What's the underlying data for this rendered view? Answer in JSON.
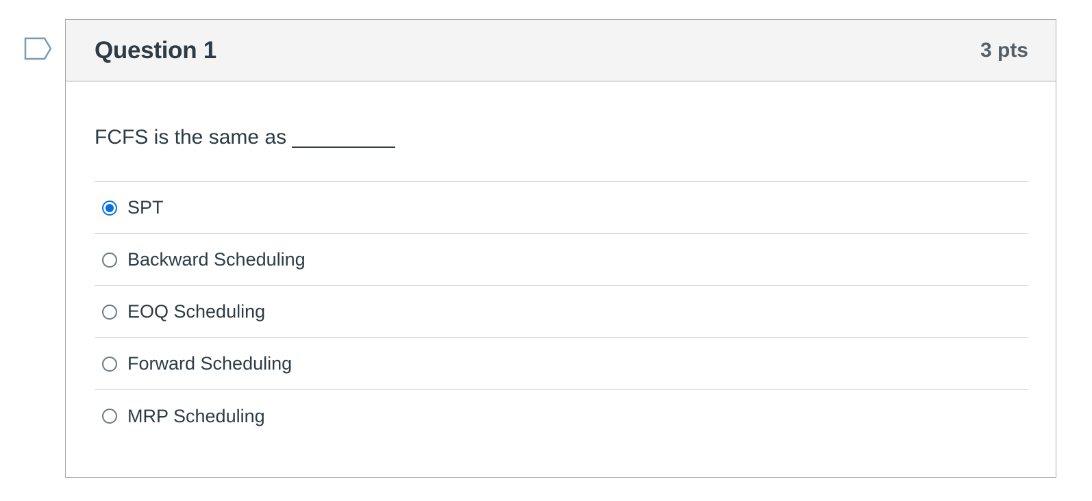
{
  "question": {
    "title": "Question 1",
    "points": "3 pts",
    "text": "FCFS is the same as _________",
    "flag_icon": "bookmark-flag-icon",
    "accent_color": "#0770e3",
    "answers": [
      {
        "label": "SPT",
        "selected": true
      },
      {
        "label": "Backward Scheduling",
        "selected": false
      },
      {
        "label": "EOQ Scheduling",
        "selected": false
      },
      {
        "label": "Forward Scheduling",
        "selected": false
      },
      {
        "label": "MRP Scheduling",
        "selected": false
      }
    ]
  }
}
